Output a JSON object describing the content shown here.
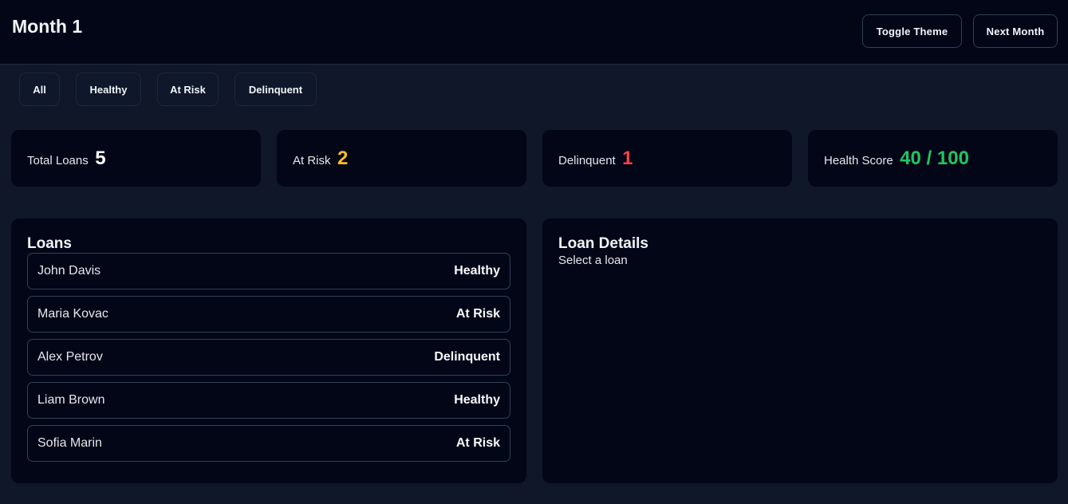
{
  "header": {
    "title": "Month 1",
    "toggle_theme_label": "Toggle Theme",
    "next_month_label": "Next Month"
  },
  "filters": {
    "all": "All",
    "healthy": "Healthy",
    "at_risk": "At Risk",
    "delinquent": "Delinquent"
  },
  "stats": {
    "total_loans": {
      "label": "Total Loans",
      "value": "5",
      "color": "#ffffff"
    },
    "at_risk": {
      "label": "At Risk",
      "value": "2",
      "color": "#fbbf24"
    },
    "delinquent": {
      "label": "Delinquent",
      "value": "1",
      "color": "#ef4444"
    },
    "health_score": {
      "label": "Health Score",
      "value": "40 / 100",
      "color": "#22c55e"
    }
  },
  "loans": {
    "title": "Loans",
    "items": [
      {
        "name": "John Davis",
        "status": "Healthy"
      },
      {
        "name": "Maria Kovac",
        "status": "At Risk"
      },
      {
        "name": "Alex Petrov",
        "status": "Delinquent"
      },
      {
        "name": "Liam Brown",
        "status": "Healthy"
      },
      {
        "name": "Sofia Marin",
        "status": "At Risk"
      }
    ]
  },
  "details": {
    "title": "Loan Details",
    "placeholder": "Select a loan"
  }
}
